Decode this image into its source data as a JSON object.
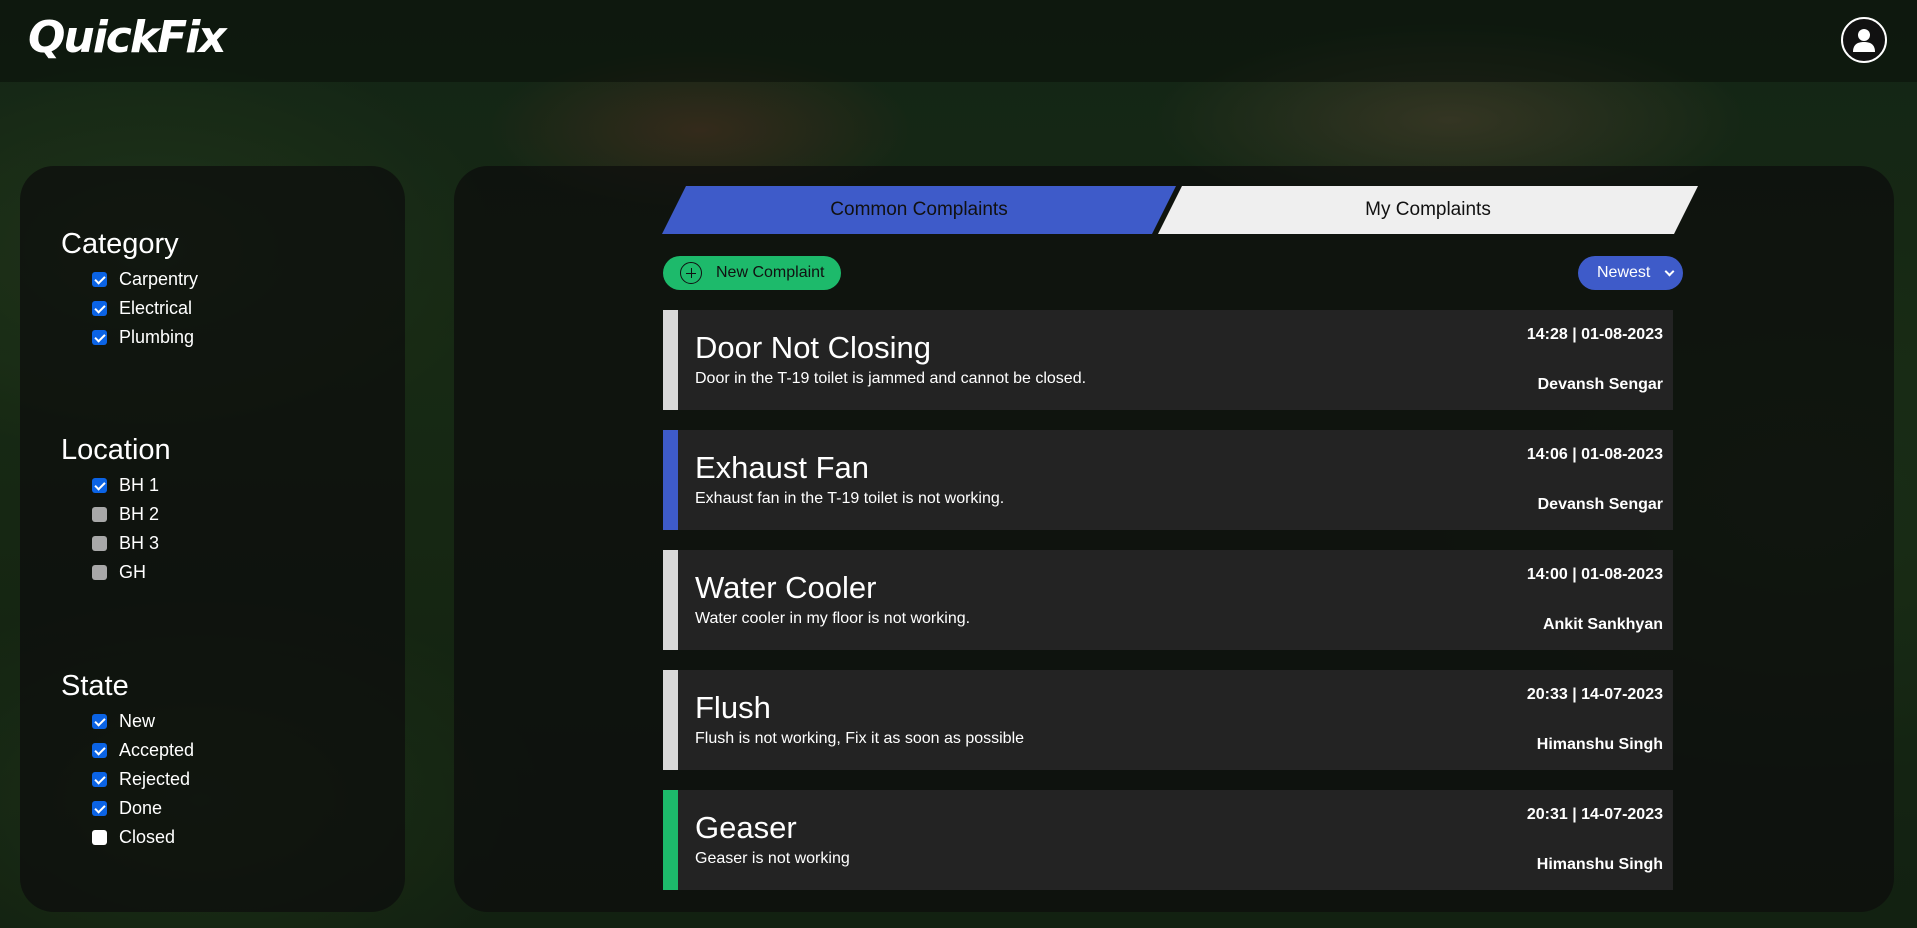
{
  "app": {
    "logo": "QuickFix"
  },
  "header": {
    "user_icon": "user-icon"
  },
  "tabs": [
    {
      "label": "Common Complaints",
      "active": true
    },
    {
      "label": "My Complaints",
      "active": false
    }
  ],
  "toolbar": {
    "new_complaint_label": "New Complaint",
    "sort_value": "Newest"
  },
  "filters": {
    "category": {
      "title": "Category",
      "options": [
        {
          "label": "Carpentry",
          "checked": true
        },
        {
          "label": "Electrical",
          "checked": true
        },
        {
          "label": "Plumbing",
          "checked": true
        }
      ]
    },
    "location": {
      "title": "Location",
      "options": [
        {
          "label": "BH 1",
          "checked": true
        },
        {
          "label": "BH 2",
          "checked": false
        },
        {
          "label": "BH 3",
          "checked": false
        },
        {
          "label": "GH",
          "checked": false
        }
      ]
    },
    "state": {
      "title": "State",
      "options": [
        {
          "label": "New",
          "checked": true
        },
        {
          "label": "Accepted",
          "checked": true
        },
        {
          "label": "Rejected",
          "checked": true
        },
        {
          "label": "Done",
          "checked": true
        },
        {
          "label": "Closed",
          "checked": false
        }
      ]
    }
  },
  "complaints": [
    {
      "title": "Door Not Closing",
      "description": "Door in the T-19 toilet is jammed and cannot be closed.",
      "time": "14:28 | 01-08-2023",
      "author": "Devansh Sengar",
      "status_color": "#d9d9d9"
    },
    {
      "title": "Exhaust Fan",
      "description": "Exhaust fan in the T-19 toilet is not working.",
      "time": "14:06 | 01-08-2023",
      "author": "Devansh Sengar",
      "status_color": "#3e5bc9"
    },
    {
      "title": "Water Cooler",
      "description": "Water cooler in my floor is not working.",
      "time": "14:00 | 01-08-2023",
      "author": "Ankit Sankhyan",
      "status_color": "#d9d9d9"
    },
    {
      "title": "Flush",
      "description": "Flush is not working, Fix it as soon as possible",
      "time": "20:33 | 14-07-2023",
      "author": "Himanshu Singh",
      "status_color": "#d9d9d9"
    },
    {
      "title": "Geaser",
      "description": "Geaser is not working",
      "time": "20:31 | 14-07-2023",
      "author": "Himanshu Singh",
      "status_color": "#1dba6b"
    }
  ],
  "colors": {
    "accent_blue": "#3e5bc9",
    "accent_green": "#1dba6b",
    "checkbox_blue": "#0b63e5"
  }
}
